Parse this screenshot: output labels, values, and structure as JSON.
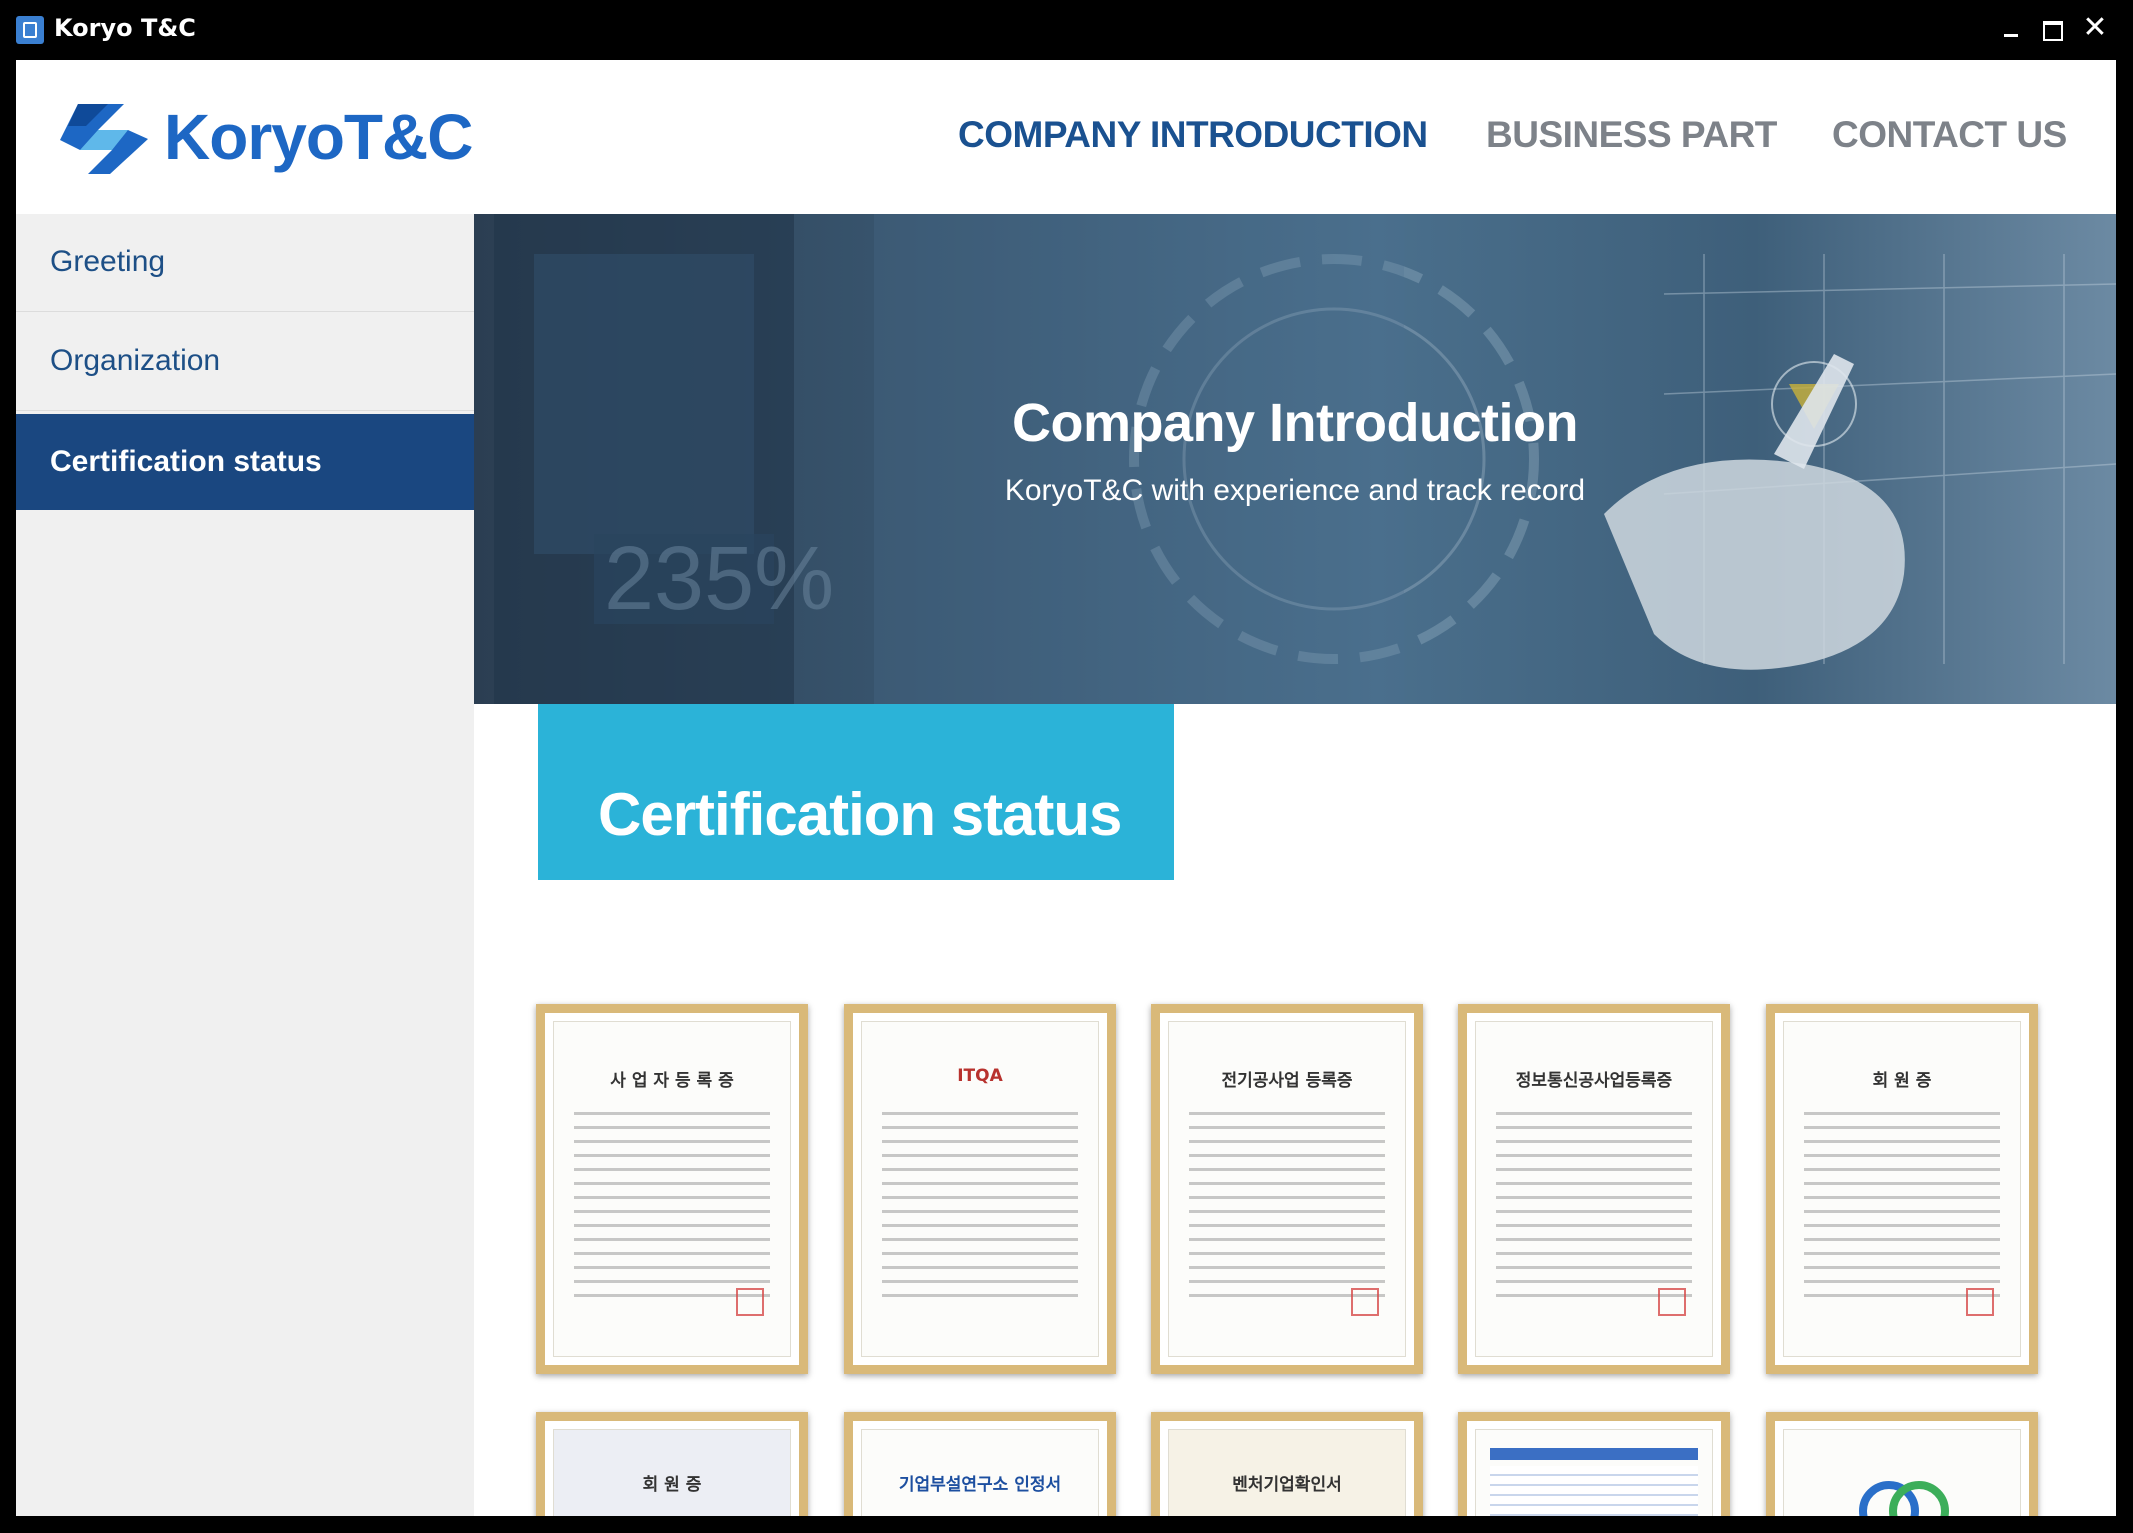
{
  "window": {
    "title": "Koryo T&C",
    "controls": {
      "minimize": "minimize",
      "maximize": "maximize",
      "close": "✕"
    }
  },
  "header": {
    "logo_text": "KoryoT&C",
    "nav": {
      "company": "COMPANY INTRODUCTION",
      "business": "BUSINESS PART",
      "contact": "CONTACT US"
    }
  },
  "sidebar": {
    "items": [
      {
        "label": "Greeting"
      },
      {
        "label": "Organization"
      },
      {
        "label": "Certification status"
      }
    ],
    "active_index": 2
  },
  "hero": {
    "title": "Company Introduction",
    "subtitle": "KoryoT&C with experience and track record"
  },
  "section": {
    "heading": "Certification status"
  },
  "certificates": [
    {
      "title": "사 업 자 등 록 증"
    },
    {
      "title": "ITQA"
    },
    {
      "title": "전기공사업 등록증"
    },
    {
      "title": "정보통신공사업등록증"
    },
    {
      "title": "회 원 증"
    },
    {
      "title": "회 원 증"
    },
    {
      "title": "기업부설연구소 인정서"
    },
    {
      "title": "벤처기업확인서"
    },
    {
      "title": ""
    },
    {
      "title": ""
    }
  ],
  "colors": {
    "brand_blue": "#1d67c4",
    "nav_active": "#1a5190",
    "sidebar_active": "#1a4780",
    "section_box": "#2bb3d8",
    "frame_gold": "#d9b979"
  }
}
